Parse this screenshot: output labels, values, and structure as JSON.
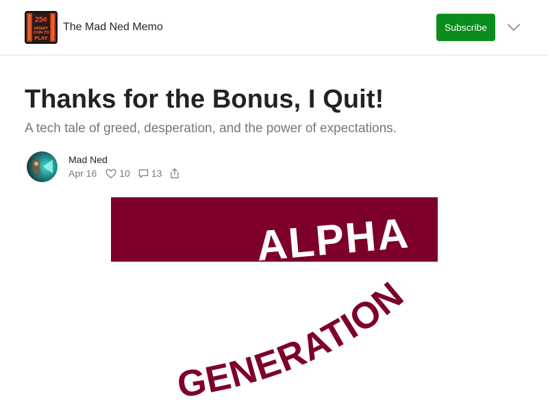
{
  "header": {
    "publication_name": "The Mad Ned Memo",
    "logo": {
      "icon": "arcade-coin-slot-logo",
      "price_text": "25¢",
      "insert_text": "INSERT",
      "coin_text": "COIN TO",
      "play_text": "PLAY"
    },
    "subscribe_label": "Subscribe",
    "menu_icon": "chevron-down-icon"
  },
  "post": {
    "title": "Thanks for the Bonus, I Quit!",
    "subtitle": "A tech tale of greed, desperation, and the power of expectations.",
    "author": "Mad Ned",
    "date": "Apr 16",
    "likes": "10",
    "comments": "13",
    "icons": {
      "like": "heart-icon",
      "comment": "comment-icon",
      "share": "share-icon"
    }
  },
  "hero": {
    "top_text": "ALPHA",
    "curved_text": "GENERATION"
  },
  "colors": {
    "accent": "#0a8d1c",
    "hero_maroon": "#7d0029",
    "muted_text": "#777777",
    "body_text": "#222222"
  }
}
